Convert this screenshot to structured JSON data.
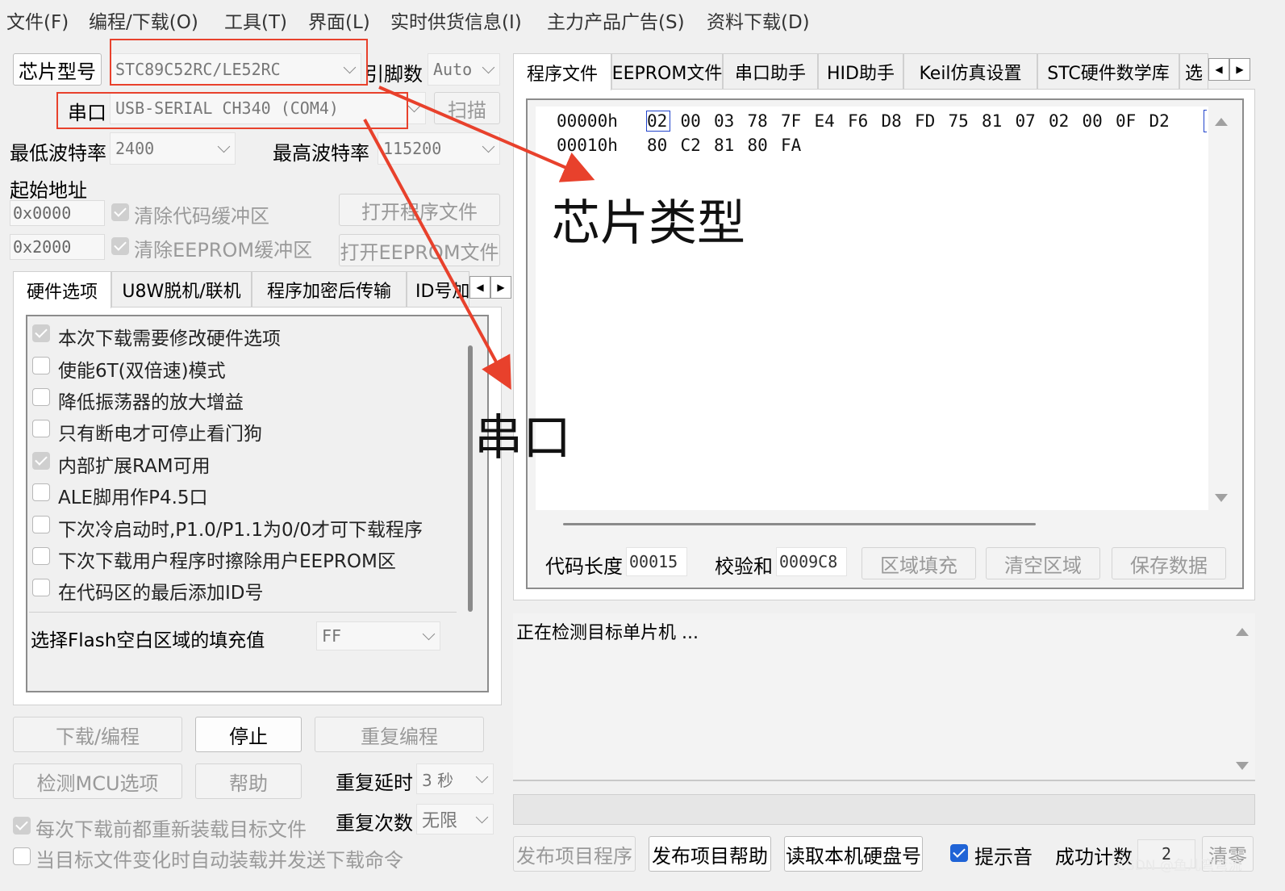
{
  "menu": [
    "文件(F)",
    "编程/下载(O)",
    "工具(T)",
    "界面(L)",
    "实时供货信息(I)",
    "主力产品广告(S)",
    "资料下载(D)"
  ],
  "left": {
    "chip_button": "芯片型号",
    "chip_value": "STC89C52RC/LE52RC",
    "pins_label": "引脚数",
    "pins_value": "Auto",
    "port_label": "串口",
    "port_value": "USB-SERIAL CH340 (COM4)",
    "scan_button": "扫描",
    "min_baud_label": "最低波特率",
    "min_baud_value": "2400",
    "max_baud_label": "最高波特率",
    "max_baud_value": "115200",
    "start_addr_label": "起始地址",
    "addr1": "0x0000",
    "addr2": "0x2000",
    "clear_code_buffer": "清除代码缓冲区",
    "clear_eeprom_buffer": "清除EEPROM缓冲区",
    "open_program_file": "打开程序文件",
    "open_eeprom_file": "打开EEPROM文件",
    "tabs": [
      "硬件选项",
      "U8W脱机/联机",
      "程序加密后传输",
      "ID号加"
    ],
    "options": [
      {
        "label": "本次下载需要修改硬件选项",
        "checked": true
      },
      {
        "label": "使能6T(双倍速)模式",
        "checked": false
      },
      {
        "label": "降低振荡器的放大增益",
        "checked": false
      },
      {
        "label": "只有断电才可停止看门狗",
        "checked": false
      },
      {
        "label": "内部扩展RAM可用",
        "checked": true
      },
      {
        "label": "ALE脚用作P4.5口",
        "checked": false
      },
      {
        "label": "下次冷启动时,P1.0/P1.1为0/0才可下载程序",
        "checked": false
      },
      {
        "label": "下次下载用户程序时擦除用户EEPROM区",
        "checked": false
      },
      {
        "label": "在代码区的最后添加ID号",
        "checked": false
      }
    ],
    "fill_label": "选择Flash空白区域的填充值",
    "fill_value": "FF",
    "download_button": "下载/编程",
    "stop_button": "停止",
    "repeat_button": "重复编程",
    "detect_button": "检测MCU选项",
    "help_button": "帮助",
    "repeat_delay_label": "重复延时",
    "repeat_delay_value": "3 秒",
    "repeat_count_label": "重复次数",
    "repeat_count_value": "无限",
    "reload_label": "每次下载前都重新装载目标文件",
    "auto_send_label": "当目标文件变化时自动装载并发送下载命令"
  },
  "right": {
    "tabs": [
      "程序文件",
      "EEPROM文件",
      "串口助手",
      "HID助手",
      "Keil仿真设置",
      "STC硬件数学库",
      "选"
    ],
    "hex_rows": [
      {
        "addr": "00000h",
        "bytes": [
          "02",
          "00",
          "03",
          "78",
          "7F",
          "E4",
          "F6",
          "D8",
          "FD",
          "75",
          "81",
          "07",
          "02",
          "00",
          "0F",
          "D2"
        ]
      },
      {
        "addr": "00010h",
        "bytes": [
          "80",
          "C2",
          "81",
          "80",
          "FA"
        ]
      }
    ],
    "code_length_label": "代码长度",
    "code_length_value": "00015",
    "checksum_label": "校验和",
    "checksum_value": "0009C8",
    "fill_region_button": "区域填充",
    "clear_region_button": "清空区域",
    "save_data_button": "保存数据",
    "log_text": "正在检测目标单片机 ...",
    "publish_program_button": "发布项目程序",
    "publish_help_button": "发布项目帮助",
    "read_hdd_button": "读取本机硬盘号",
    "beep_label": "提示音",
    "success_count_label": "成功计数",
    "success_count_value": "2",
    "clear_count_button": "清零"
  },
  "annotations": {
    "chip_type": "芯片类型",
    "serial_port": "串口",
    "color": "#e8412c"
  },
  "watermark": "CSDN @鱼儿弯弯流"
}
